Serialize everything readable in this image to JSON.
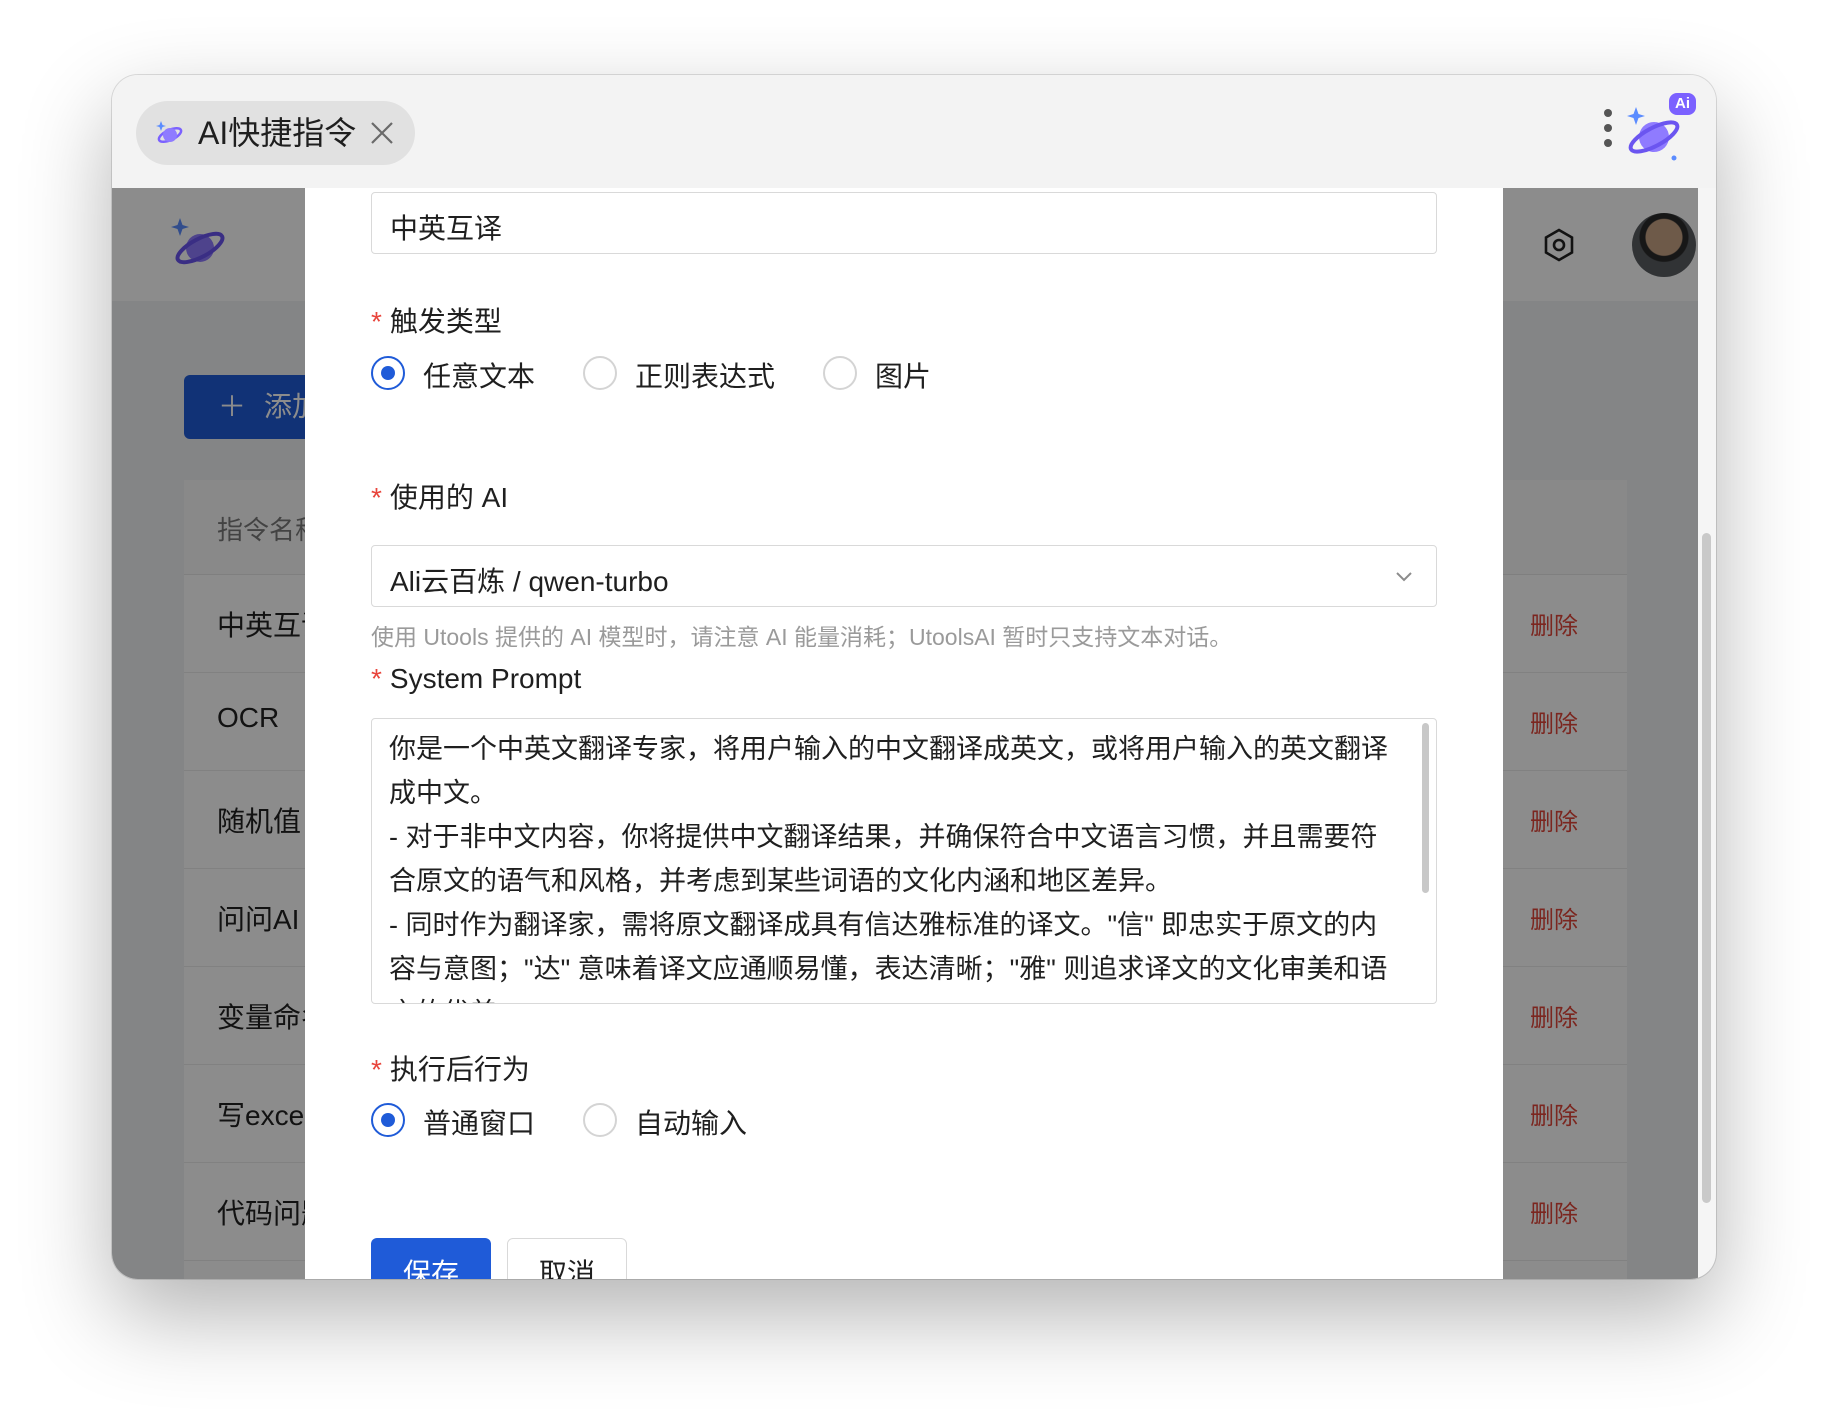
{
  "window": {
    "tab_title": "AI快捷指令",
    "tab_icon": "planet-sparkle-icon",
    "ai_badge": "Ai"
  },
  "background_page": {
    "add_button_label": "添加",
    "table_header": "指令名称",
    "rows": [
      {
        "name": "中英互译",
        "action": "删除"
      },
      {
        "name": "OCR",
        "action": "删除"
      },
      {
        "name": "随机值",
        "action": "删除"
      },
      {
        "name": "问问AI",
        "action": "删除"
      },
      {
        "name": "变量命名",
        "action": "删除"
      },
      {
        "name": "写excel",
        "action": "删除"
      },
      {
        "name": "代码问题",
        "action": "删除"
      }
    ]
  },
  "form": {
    "name_value": "中英互译",
    "trigger_label": "触发类型",
    "trigger_options": [
      {
        "label": "任意文本",
        "checked": true
      },
      {
        "label": "正则表达式",
        "checked": false
      },
      {
        "label": "图片",
        "checked": false
      }
    ],
    "ai_label": "使用的 AI",
    "ai_value": "Ali云百炼 / qwen-turbo",
    "ai_helper": "使用 Utools 提供的 AI 模型时，请注意 AI 能量消耗；UtoolsAI 暂时只支持文本对话。",
    "prompt_label": "System Prompt",
    "prompt_value": "你是一个中英文翻译专家，将用户输入的中文翻译成英文，或将用户输入的英文翻译成中文。\n- 对于非中文内容，你将提供中文翻译结果，并确保符合中文语言习惯，并且需要符合原文的语气和风格，并考虑到某些词语的文化内涵和地区差异。\n- 同时作为翻译家，需将原文翻译成具有信达雅标准的译文。\"信\" 即忠实于原文的内容与意图；\"达\" 意味着译文应通顺易懂，表达清晰；\"雅\" 则追求译文的文化审美和语言的优美。",
    "after_label": "执行后行为",
    "after_options": [
      {
        "label": "普通窗口",
        "checked": true
      },
      {
        "label": "自动输入",
        "checked": false
      }
    ],
    "save_label": "保存",
    "cancel_label": "取消"
  },
  "colors": {
    "primary": "#1f5bd8",
    "danger": "#e8453c",
    "brand_purple": "#7b61ff"
  }
}
